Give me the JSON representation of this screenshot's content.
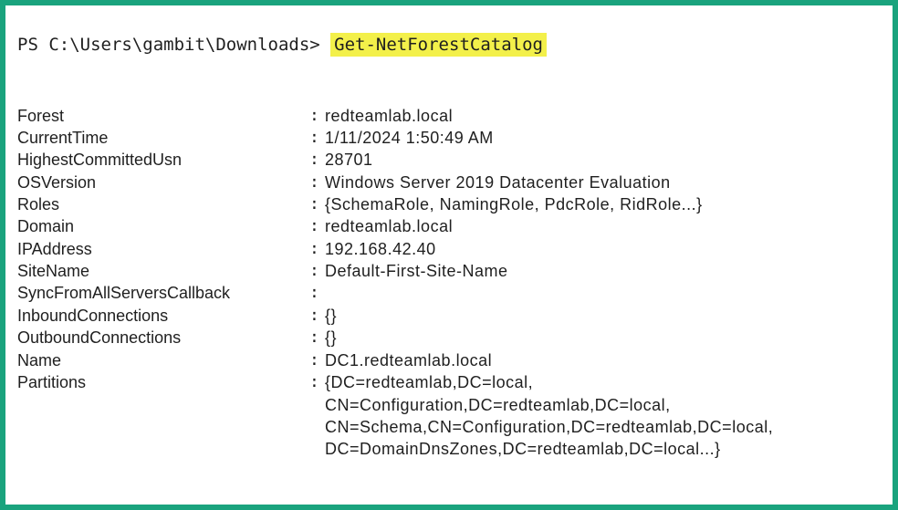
{
  "prompt": {
    "path": "PS C:\\Users\\gambit\\Downloads> ",
    "command": "Get-NetForestCatalog"
  },
  "output": {
    "rows": [
      {
        "key": "Forest",
        "sep": ":",
        "value": "redteamlab.local"
      },
      {
        "key": "CurrentTime",
        "sep": ":",
        "value": "1/11/2024 1:50:49 AM"
      },
      {
        "key": "HighestCommittedUsn",
        "sep": ":",
        "value": "28701"
      },
      {
        "key": "OSVersion",
        "sep": ":",
        "value": "Windows Server 2019 Datacenter Evaluation"
      },
      {
        "key": "Roles",
        "sep": ":",
        "value": "{SchemaRole, NamingRole, PdcRole, RidRole...}"
      },
      {
        "key": "Domain",
        "sep": ":",
        "value": "redteamlab.local"
      },
      {
        "key": "IPAddress",
        "sep": ":",
        "value": "192.168.42.40"
      },
      {
        "key": "SiteName",
        "sep": ":",
        "value": "Default-First-Site-Name"
      },
      {
        "key": "SyncFromAllServersCallback",
        "sep": ":",
        "value": ""
      },
      {
        "key": "InboundConnections",
        "sep": ":",
        "value": "{}"
      },
      {
        "key": "OutboundConnections",
        "sep": ":",
        "value": "{}"
      },
      {
        "key": "Name",
        "sep": ":",
        "value": "DC1.redteamlab.local"
      },
      {
        "key": "Partitions",
        "sep": ":",
        "value": "{DC=redteamlab,DC=local,"
      }
    ],
    "partitions_continuation": [
      "CN=Configuration,DC=redteamlab,DC=local,",
      "CN=Schema,CN=Configuration,DC=redteamlab,DC=local,",
      "DC=DomainDnsZones,DC=redteamlab,DC=local...}"
    ]
  }
}
